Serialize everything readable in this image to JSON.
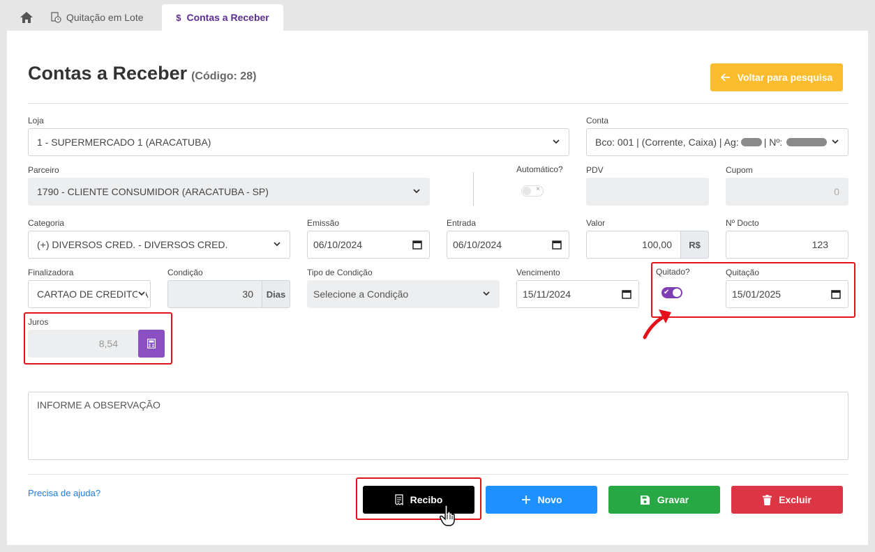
{
  "tabs": [
    {
      "label": "Quitação em Lote"
    },
    {
      "label": "Contas a Receber"
    }
  ],
  "page": {
    "title": "Contas a Receber",
    "code": "(Código: 28)",
    "back_label": "Voltar para pesquisa"
  },
  "form": {
    "loja": {
      "label": "Loja",
      "value": "1 - SUPERMERCADO 1 (ARACATUBA)"
    },
    "conta": {
      "label": "Conta",
      "value": "Bco: 001 | (Corrente, Caixa) | Ag:",
      "value_suffix": "| Nº:"
    },
    "parceiro": {
      "label": "Parceiro",
      "value": "1790 - CLIENTE CONSUMIDOR  (ARACATUBA - SP)"
    },
    "automatico": {
      "label": "Automático?",
      "checked": false
    },
    "pdv": {
      "label": "PDV",
      "value": ""
    },
    "cupom": {
      "label": "Cupom",
      "value": "0"
    },
    "categoria": {
      "label": "Categoria",
      "value": "(+) DIVERSOS CRED. - DIVERSOS CRED."
    },
    "emissao": {
      "label": "Emissão",
      "value": "06/10/2024"
    },
    "entrada": {
      "label": "Entrada",
      "value": "06/10/2024"
    },
    "valor": {
      "label": "Valor",
      "value": "100,00",
      "addon": "R$"
    },
    "ndocto": {
      "label": "Nº Docto",
      "value": "123"
    },
    "finalizadora": {
      "label": "Finalizadora",
      "value": "CARTAO DE CREDITO A"
    },
    "condicao": {
      "label": "Condição",
      "value": "30",
      "addon": "Dias"
    },
    "tipo_condicao": {
      "label": "Tipo de Condição",
      "placeholder": "Selecione a Condição"
    },
    "vencimento": {
      "label": "Vencimento",
      "value": "15/11/2024"
    },
    "quitado": {
      "label": "Quitado?",
      "checked": true
    },
    "quitacao": {
      "label": "Quitação",
      "value": "15/01/2025"
    },
    "juros": {
      "label": "Juros",
      "value": "8,54"
    },
    "observacao": {
      "placeholder": "INFORME A OBSERVAÇÃO"
    }
  },
  "footer": {
    "help": "Precisa de ajuda?",
    "recibo": "Recibo",
    "novo": "Novo",
    "gravar": "Gravar",
    "excluir": "Excluir"
  },
  "colors": {
    "accent": "#7e3fb5",
    "warning": "#fbbd2e",
    "primary": "#1e90ff",
    "success": "#28a745",
    "danger": "#dc3545",
    "highlight": "#e4101a"
  }
}
